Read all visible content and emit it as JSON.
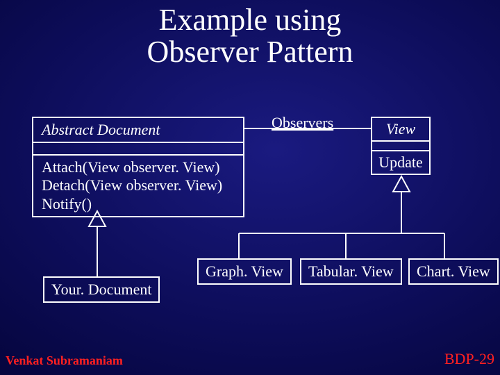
{
  "title_line1": "Example using",
  "title_line2": "Observer Pattern",
  "abstract_document": {
    "name": "Abstract Document",
    "ops": [
      "Attach(View observer. View)",
      "Detach(View observer. View)",
      "Notify()"
    ]
  },
  "view": {
    "name": "View",
    "ops": [
      "Update"
    ]
  },
  "association_label": "Observers",
  "your_document": "Your. Document",
  "graph_view": "Graph. View",
  "tabular_view": "Tabular. View",
  "chart_view": "Chart. View",
  "footer_author": "Venkat Subramaniam",
  "footer_page": "BDP-29"
}
